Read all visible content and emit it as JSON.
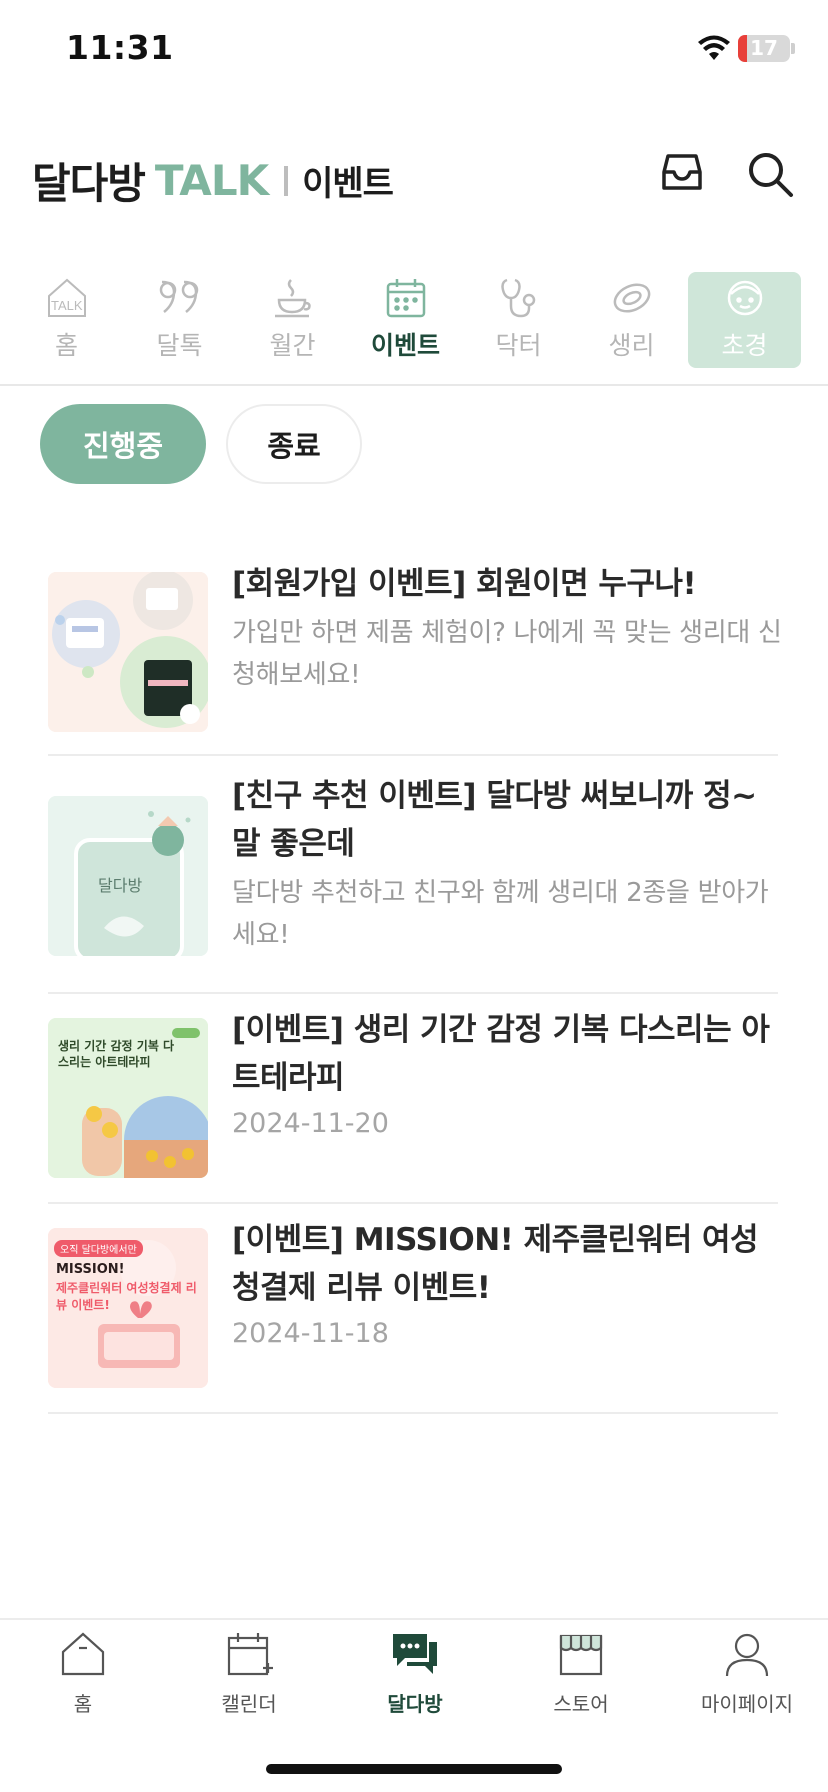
{
  "status_bar": {
    "time": "11:31",
    "battery_level": "17",
    "battery_color": "#e8403a"
  },
  "header": {
    "brand_main": "달다방",
    "brand_accent": "TALK",
    "sub_title": "이벤트",
    "icons": [
      "inbox-icon",
      "search-icon"
    ],
    "accent_color": "#7fb59e"
  },
  "category_tabs": [
    {
      "label": "홈",
      "icon": "talk-home-icon",
      "state": "inactive"
    },
    {
      "label": "달톡",
      "icon": "quote-icon",
      "state": "inactive"
    },
    {
      "label": "월간",
      "icon": "coffee-cup-icon",
      "state": "inactive"
    },
    {
      "label": "이벤트",
      "icon": "calendar-event-icon",
      "state": "active"
    },
    {
      "label": "닥터",
      "icon": "stethoscope-icon",
      "state": "inactive"
    },
    {
      "label": "생리",
      "icon": "pad-icon",
      "state": "inactive"
    },
    {
      "label": "초경",
      "icon": "girl-face-icon",
      "state": "highlight"
    }
  ],
  "filters": {
    "active": "진행중",
    "inactive": "종료"
  },
  "events": [
    {
      "title": "[회원가입 이벤트] 회원이면 누구나!",
      "desc": "가입만 하면 제품 체험이? 나에게 꼭 맞는 생리대 신청해보세요!",
      "date": ""
    },
    {
      "title": "[친구 추천 이벤트] 달다방 써보니까 정~말 좋은데",
      "desc": "달다방 추천하고 친구와 함께 생리대 2종을 받아가세요!",
      "date": "",
      "thumb_text": "달다방"
    },
    {
      "title": "[이벤트] 생리 기간 감정 기복 다스리는 아트테라피",
      "desc": "",
      "date": "2024-11-20",
      "thumb_text": "생리 기간 감정 기복 다스리는 아트테라피"
    },
    {
      "title": "[이벤트] MISSION! 제주클린워터 여성청결제 리뷰 이벤트!",
      "desc": "",
      "date": "2024-11-18",
      "thumb_badge": "오직 달다방에서만",
      "thumb_text": "MISSION!",
      "thumb_text2": "제주클린워터 여성청결제 리뷰 이벤트!"
    }
  ],
  "bottom_nav": [
    {
      "label": "홈",
      "icon": "home-icon",
      "active": false
    },
    {
      "label": "캘린더",
      "icon": "calendar-add-icon",
      "active": false
    },
    {
      "label": "달다방",
      "icon": "chat-bubbles-icon",
      "active": true
    },
    {
      "label": "스토어",
      "icon": "store-icon",
      "active": false
    },
    {
      "label": "마이페이지",
      "icon": "person-icon",
      "active": false
    }
  ]
}
